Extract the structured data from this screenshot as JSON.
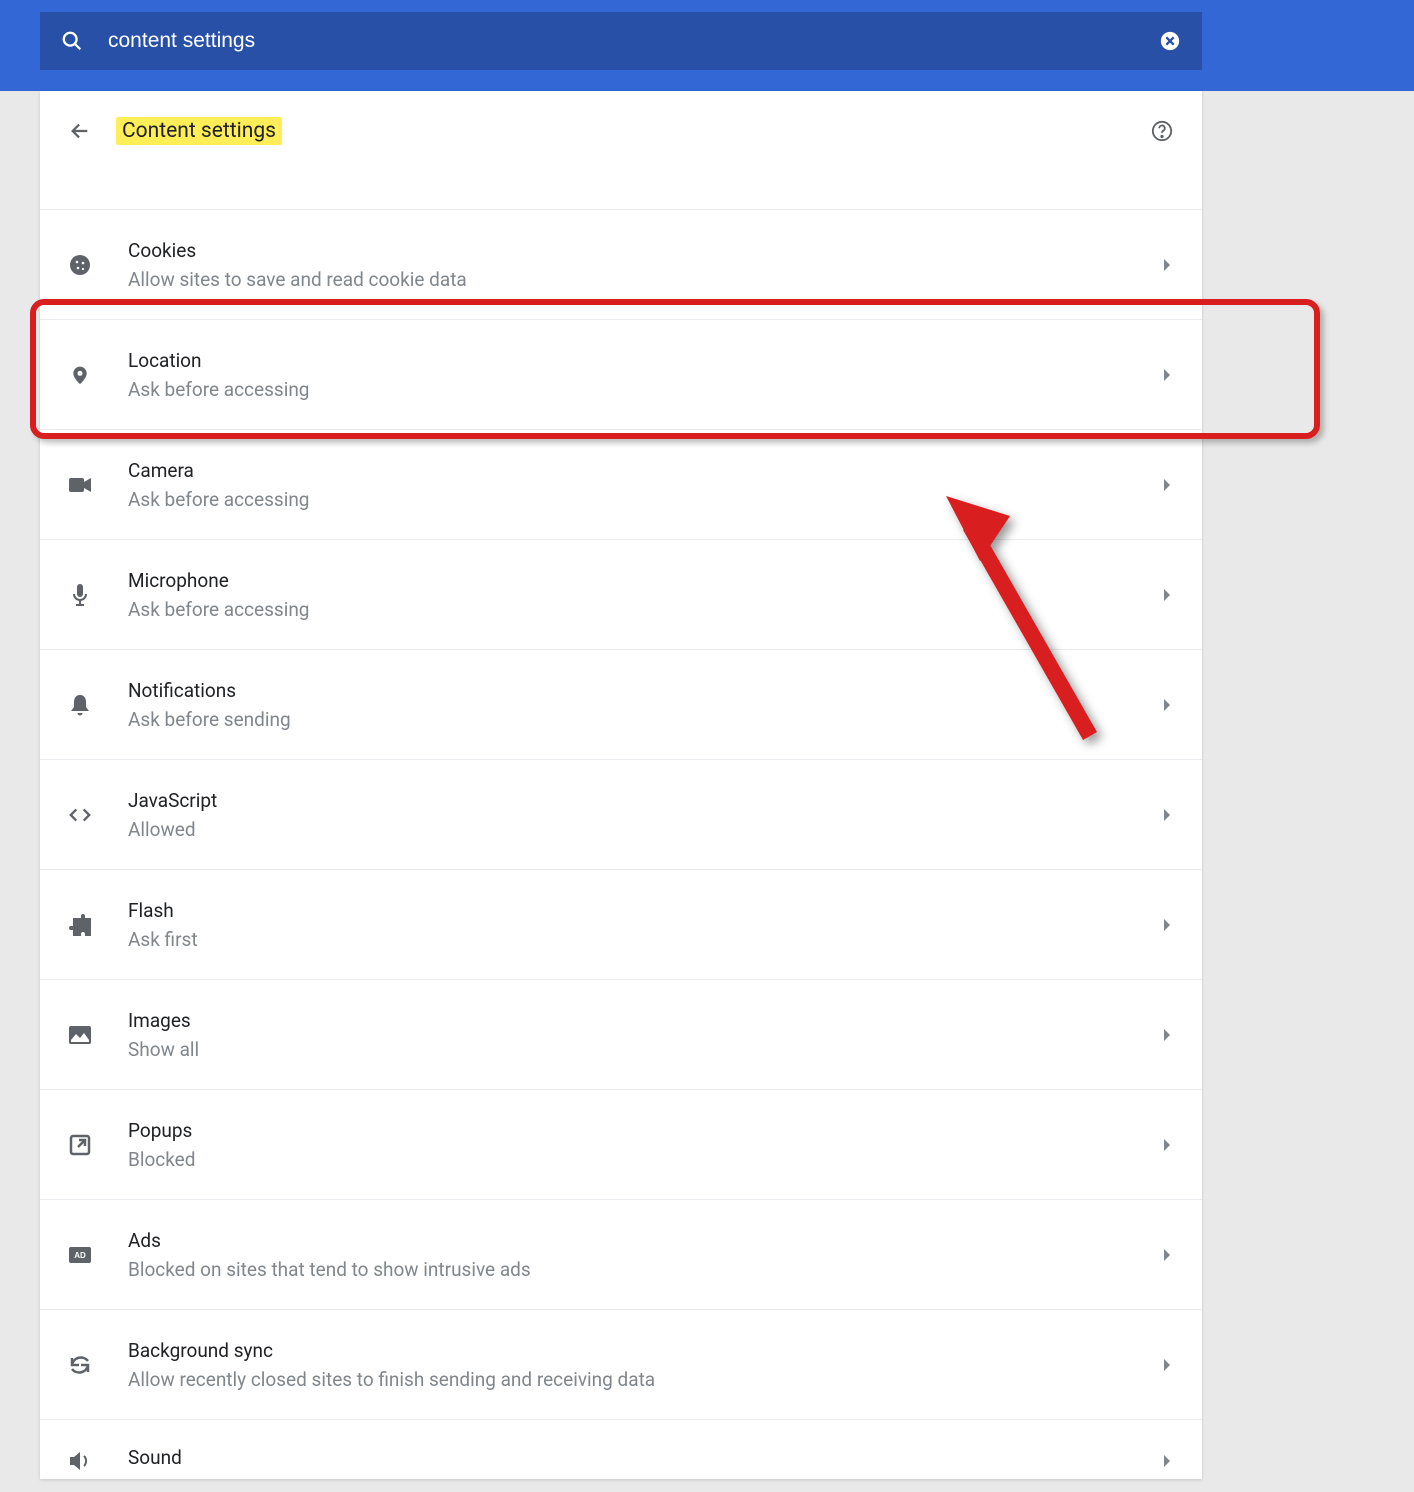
{
  "search": {
    "value": "content settings"
  },
  "header": {
    "title": "Content settings"
  },
  "items": [
    {
      "key": "cookies",
      "title": "Cookies",
      "sub": "Allow sites to save and read cookie data",
      "icon": "cookie-icon"
    },
    {
      "key": "location",
      "title": "Location",
      "sub": "Ask before accessing",
      "icon": "location-icon"
    },
    {
      "key": "camera",
      "title": "Camera",
      "sub": "Ask before accessing",
      "icon": "camera-icon"
    },
    {
      "key": "microphone",
      "title": "Microphone",
      "sub": "Ask before accessing",
      "icon": "microphone-icon"
    },
    {
      "key": "notifications",
      "title": "Notifications",
      "sub": "Ask before sending",
      "icon": "bell-icon"
    },
    {
      "key": "javascript",
      "title": "JavaScript",
      "sub": "Allowed",
      "icon": "code-icon"
    },
    {
      "key": "flash",
      "title": "Flash",
      "sub": "Ask first",
      "icon": "puzzle-icon"
    },
    {
      "key": "images",
      "title": "Images",
      "sub": "Show all",
      "icon": "image-icon"
    },
    {
      "key": "popups",
      "title": "Popups",
      "sub": "Blocked",
      "icon": "popup-icon"
    },
    {
      "key": "ads",
      "title": "Ads",
      "sub": "Blocked on sites that tend to show intrusive ads",
      "icon": "ads-icon"
    },
    {
      "key": "background-sync",
      "title": "Background sync",
      "sub": "Allow recently closed sites to finish sending and receiving data",
      "icon": "sync-icon"
    },
    {
      "key": "sound",
      "title": "Sound",
      "sub": "",
      "icon": "sound-icon"
    }
  ]
}
